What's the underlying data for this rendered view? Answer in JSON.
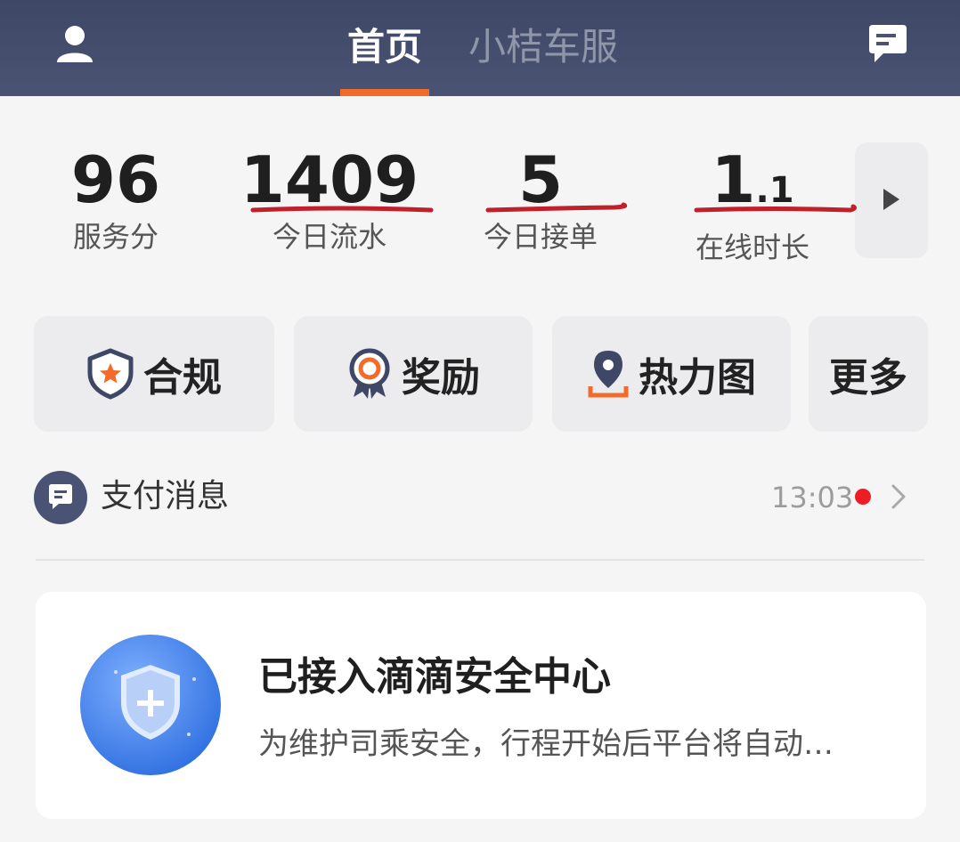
{
  "header": {
    "tabs": [
      {
        "label": "首页"
      },
      {
        "label": "小桔车服"
      }
    ]
  },
  "stats": {
    "score": {
      "value": "96",
      "label": "服务分"
    },
    "flow": {
      "value": "1409",
      "label": "今日流水"
    },
    "orders": {
      "value": "5",
      "label": "今日接单"
    },
    "online": {
      "value_int": "1",
      "value_dec": ".1",
      "label": "在线时长"
    }
  },
  "actions": [
    {
      "label": "合规",
      "icon": "shield-star-icon"
    },
    {
      "label": "奖励",
      "icon": "medal-icon"
    },
    {
      "label": "热力图",
      "icon": "location-pin-icon"
    },
    {
      "label": "更多"
    }
  ],
  "payment": {
    "title": "支付消息",
    "time": "13:03"
  },
  "safety": {
    "title": "已接入滴滴安全中心",
    "description": "为维护司乘安全，行程开始后平台将自动…"
  },
  "colors": {
    "header_bg": "#454d6c",
    "accent_orange": "#f26b2a",
    "annotation_red": "#c0202a",
    "unread_dot": "#ee1c25",
    "safety_blue": "#3f7de8"
  }
}
